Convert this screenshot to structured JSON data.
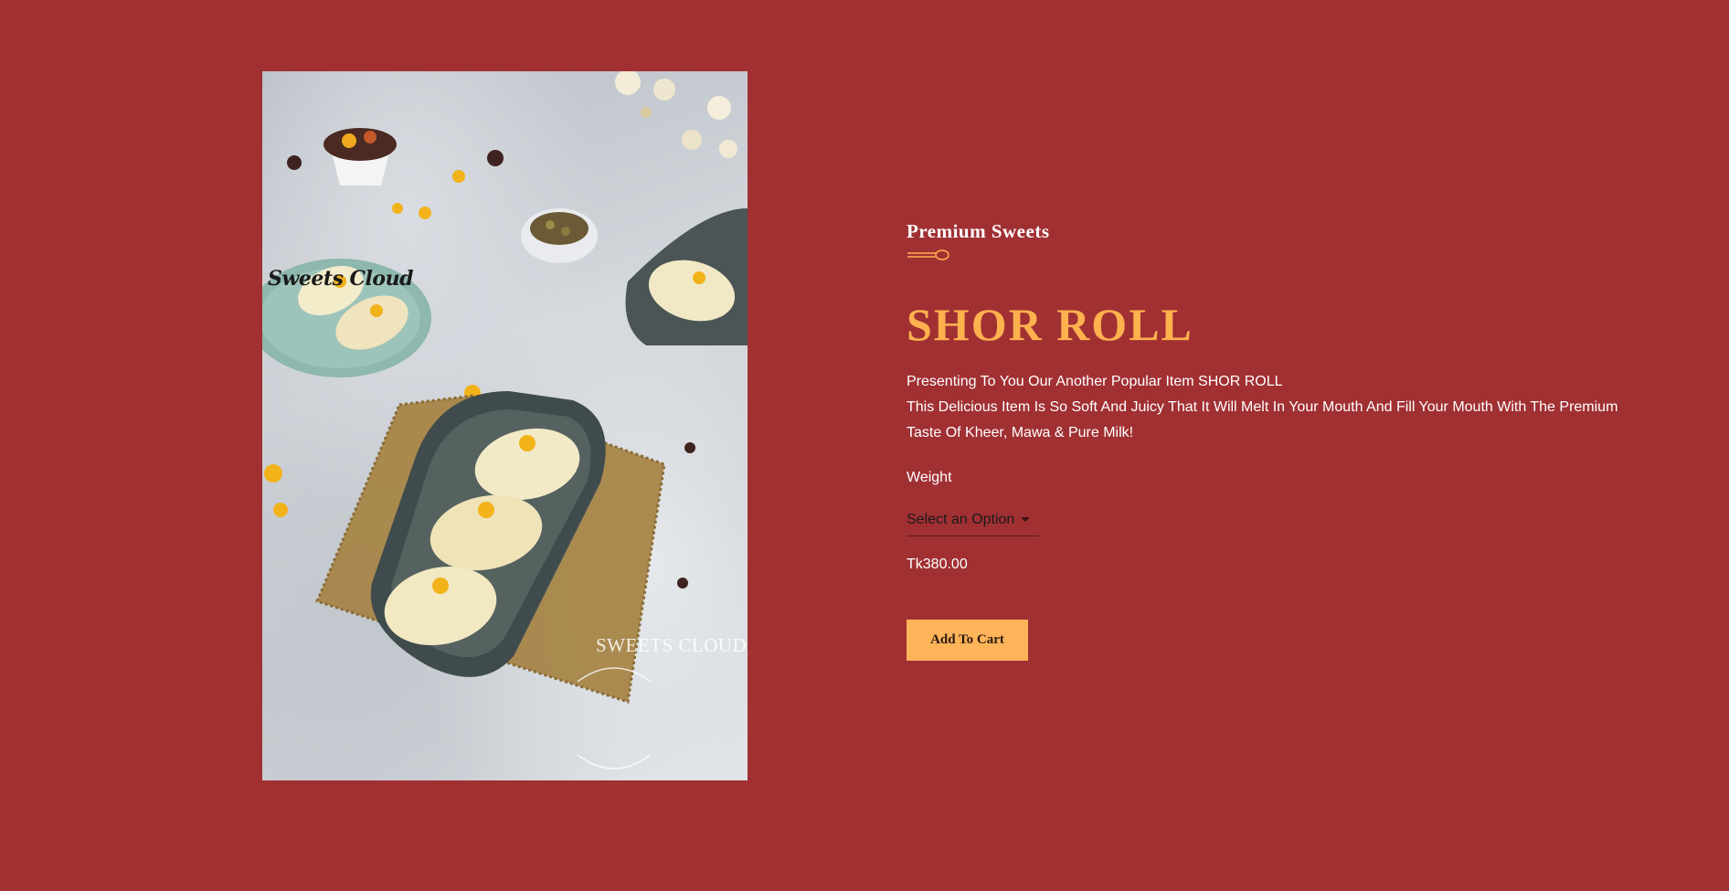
{
  "product": {
    "image_caption": "Sweets Cloud",
    "watermark": "SWEETS CLOUD",
    "category": "Premium Sweets",
    "name": "SHOR ROLL",
    "description_lines": [
      "Presenting To You Our Another Popular Item SHOR ROLL",
      "This Delicious Item Is So Soft And Juicy That It Will Melt In Your Mouth And Fill Your Mouth With The Premium Taste Of Kheer, Mawa & Pure Milk!"
    ],
    "weight_label": "Weight",
    "weight_select": {
      "selected": "Select an Option"
    },
    "price": "Tk380.00",
    "add_to_cart_label": "Add To Cart"
  },
  "colors": {
    "background": "#a13033",
    "title": "#ffb14e",
    "button": "#ffb45a",
    "text": "#ffffff"
  }
}
